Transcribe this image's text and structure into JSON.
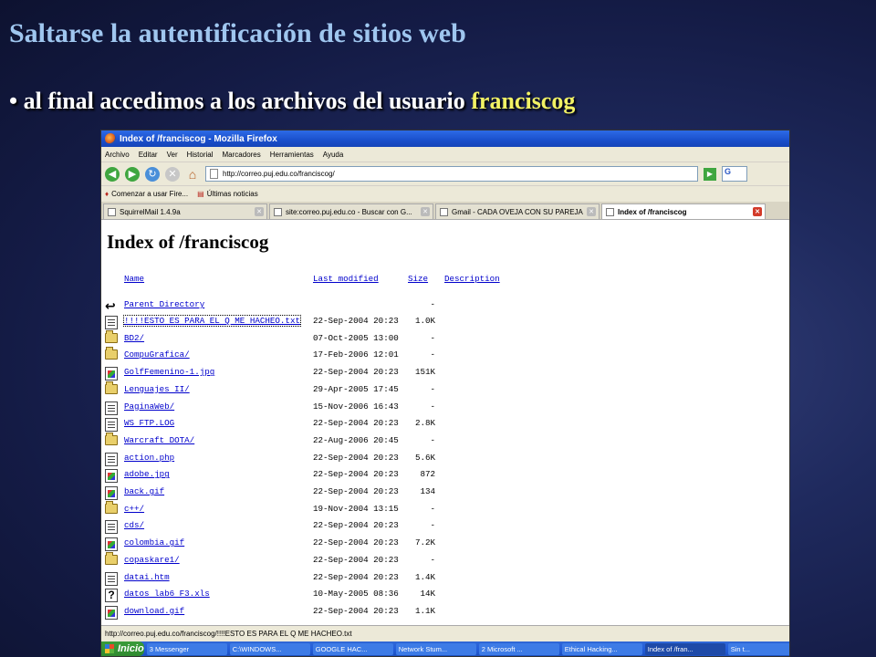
{
  "slide": {
    "title": "Saltarse la autentificación de sitios web",
    "bullet_prefix": "• al final accedimos a los archivos del usuario ",
    "bullet_highlight": "franciscog"
  },
  "browser": {
    "window_title": "Index of /franciscog - Mozilla Firefox",
    "menu": [
      "Archivo",
      "Editar",
      "Ver",
      "Historial",
      "Marcadores",
      "Herramientas",
      "Ayuda"
    ],
    "url": "http://correo.puj.edu.co/franciscog/",
    "search_label": "G",
    "bookmarks": [
      "Comenzar a usar Fire...",
      "Últimas noticias"
    ],
    "tabs": [
      {
        "label": "SquirrelMail 1.4.9a"
      },
      {
        "label": "site:correo.puj.edu.co - Buscar con G..."
      },
      {
        "label": "Gmail - CADA OVEJA CON SU PAREJA"
      },
      {
        "label": "Index of /franciscog"
      }
    ],
    "status_text": "http://correo.puj.edu.co/franciscog/!!!!ESTO ES PARA EL Q ME HACHEO.txt"
  },
  "listing": {
    "heading": "Index of /franciscog",
    "columns": {
      "name": "Name",
      "modified": "Last modified",
      "size": "Size",
      "description": "Description"
    },
    "parent": {
      "name": "Parent Directory",
      "size": "-"
    },
    "rows": [
      {
        "icon": "text",
        "name": "!!!!ESTO ES PARA EL Q ME HACHEO.txt",
        "modified": "22-Sep-2004 20:23",
        "size": "1.0K"
      },
      {
        "icon": "folder",
        "name": "BD2/",
        "modified": "07-Oct-2005 13:00",
        "size": "-"
      },
      {
        "icon": "folder",
        "name": "CompuGrafica/",
        "modified": "17-Feb-2006 12:01",
        "size": "-"
      },
      {
        "icon": "image",
        "name": "GolfFemenino-1.jpg",
        "modified": "22-Sep-2004 20:23",
        "size": "151K"
      },
      {
        "icon": "folder",
        "name": "Lenguajes II/",
        "modified": "29-Apr-2005 17:45",
        "size": "-"
      },
      {
        "icon": "text",
        "name": "PaginaWeb/",
        "modified": "15-Nov-2006 16:43",
        "size": "-"
      },
      {
        "icon": "text",
        "name": "WS FTP.LOG",
        "modified": "22-Sep-2004 20:23",
        "size": "2.8K"
      },
      {
        "icon": "folder",
        "name": "Warcraft DOTA/",
        "modified": "22-Aug-2006 20:45",
        "size": "-"
      },
      {
        "icon": "text",
        "name": "action.php",
        "modified": "22-Sep-2004 20:23",
        "size": "5.6K"
      },
      {
        "icon": "image",
        "name": "adobe.jpg",
        "modified": "22-Sep-2004 20:23",
        "size": "872"
      },
      {
        "icon": "image",
        "name": "back.gif",
        "modified": "22-Sep-2004 20:23",
        "size": "134"
      },
      {
        "icon": "folder",
        "name": "c++/",
        "modified": "19-Nov-2004 13:15",
        "size": "-"
      },
      {
        "icon": "text",
        "name": "cds/",
        "modified": "22-Sep-2004 20:23",
        "size": "-"
      },
      {
        "icon": "image",
        "name": "colombia.gif",
        "modified": "22-Sep-2004 20:23",
        "size": "7.2K"
      },
      {
        "icon": "folder",
        "name": "copaskare1/",
        "modified": "22-Sep-2004 20:23",
        "size": "-"
      },
      {
        "icon": "text",
        "name": "datai.htm",
        "modified": "22-Sep-2004 20:23",
        "size": "1.4K"
      },
      {
        "icon": "unknown",
        "name": "datos lab6 F3.xls",
        "modified": "10-May-2005 08:36",
        "size": "14K"
      },
      {
        "icon": "image",
        "name": "download.gif",
        "modified": "22-Sep-2004 20:23",
        "size": "1.1K"
      }
    ]
  },
  "taskbar": {
    "start_label": "Inicio",
    "tasks": [
      "3 Messenger",
      "C:\\WINDOWS...",
      "GOOGLE HAC...",
      "Network Stum...",
      "2 Microsoft ...",
      "Ethical Hacking...",
      "Index of /fran...",
      "Sin t..."
    ],
    "active_task_index": 6
  }
}
